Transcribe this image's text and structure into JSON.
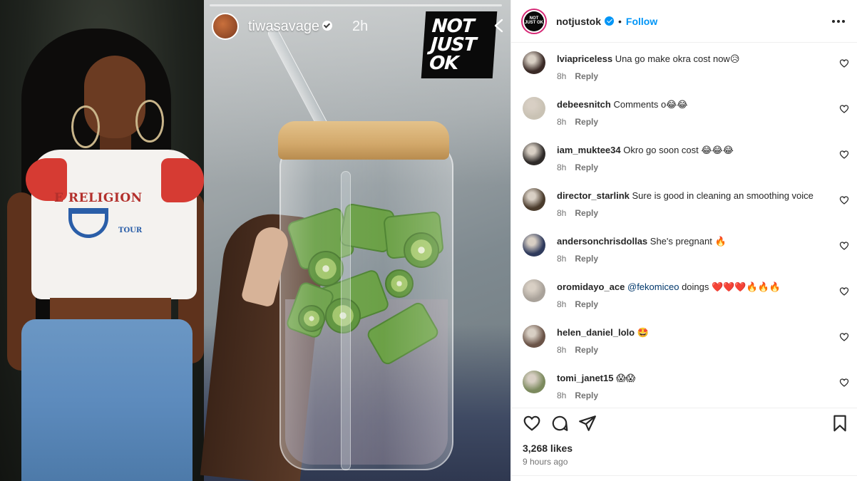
{
  "story": {
    "username": "tiwasavage",
    "time": "2h",
    "brand_line1": "NOT",
    "brand_line2": "JUST",
    "brand_line3": "OK"
  },
  "shirt": {
    "text": "E RELIGION",
    "tour": "TOUR"
  },
  "post": {
    "username": "notjustok",
    "dot": "•",
    "follow_label": "Follow",
    "avatar_text": "NOT JUST OK",
    "likes": "3,268 likes",
    "time_ago": "9 hours ago"
  },
  "comments": [
    {
      "user": "lviapriceless",
      "text": "Una go make okra cost now😥",
      "time": "8h",
      "reply": "Reply",
      "avatar_color": "#3a2a26"
    },
    {
      "user": "debeesnitch",
      "text": "Comments o😂😂",
      "time": "8h",
      "reply": "Reply",
      "avatar_color": "#c9c2b4"
    },
    {
      "user": "iam_muktee34",
      "text": "Okro go soon cost 😂😂😂",
      "time": "8h",
      "reply": "Reply",
      "avatar_color": "#2e2a28"
    },
    {
      "user": "director_starlink",
      "text": "Sure is good in cleaning an smoothing voice",
      "time": "8h",
      "reply": "Reply",
      "avatar_color": "#4a3b2c"
    },
    {
      "user": "andersonchrisdollas",
      "text": "She's pregnant 🔥",
      "time": "8h",
      "reply": "Reply",
      "avatar_color": "#2f3a5c"
    },
    {
      "user": "oromidayo_ace",
      "mention": "@fekomiceo",
      "text": "doings ❤️❤️❤️🔥🔥🔥",
      "time": "8h",
      "reply": "Reply",
      "avatar_color": "#a9a29a"
    },
    {
      "user": "helen_daniel_lolo",
      "text": "🤩",
      "time": "8h",
      "reply": "Reply",
      "avatar_color": "#6b5448"
    },
    {
      "user": "tomi_janet15",
      "text": "😱😱",
      "time": "8h",
      "reply": "Reply",
      "avatar_color": "#7c8a5e"
    }
  ],
  "icons": {
    "like": "heart-icon",
    "comment": "comment-icon",
    "share": "share-icon",
    "save": "bookmark-icon",
    "more": "more-options-icon",
    "close": "chevron-left-icon"
  },
  "colors": {
    "accent": "#0095f6",
    "text": "#262626",
    "muted": "#737373",
    "border": "#efefef",
    "mention": "#00376b"
  }
}
